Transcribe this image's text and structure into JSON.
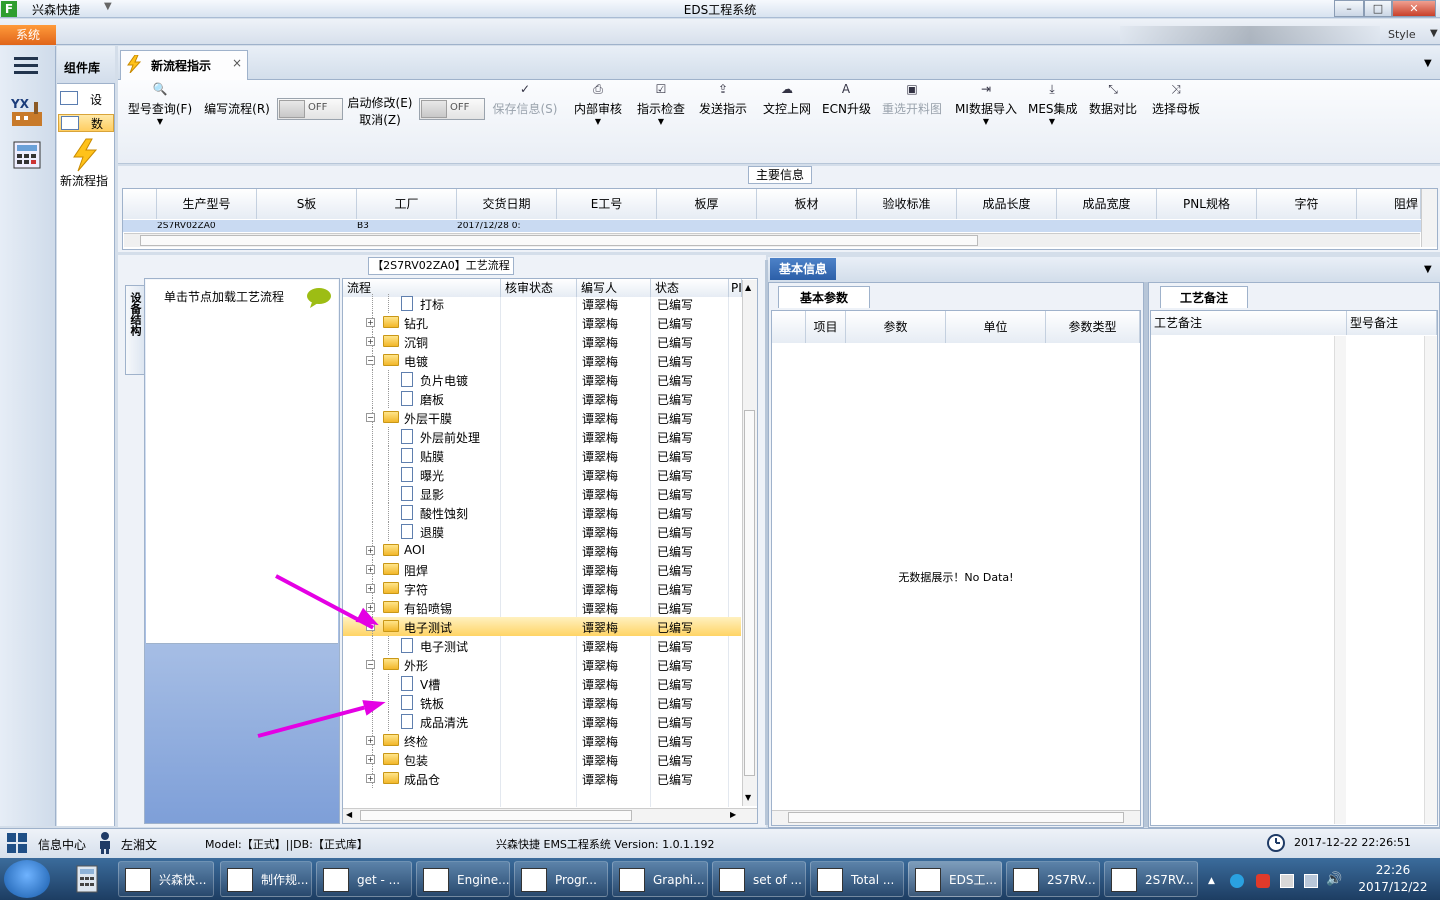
{
  "window": {
    "app_name": "兴森快捷",
    "title": "EDS工程系统"
  },
  "ribbon": {
    "system_tab": "系统",
    "style_label": "Style"
  },
  "component_library": {
    "header": "组件库",
    "items": [
      {
        "label": "设"
      },
      {
        "label": "数"
      }
    ],
    "new_flow_label": "新流程指"
  },
  "main_tab": {
    "label": "新流程指示"
  },
  "toolbar": {
    "query_model": "型号查询(F)",
    "write_flow": "编写流程(R)",
    "toggle1": "OFF",
    "start_modify": "启动修改(E)",
    "cancel": "取消(Z)",
    "toggle2": "OFF",
    "save_info": "保存信息(S)",
    "internal_review": "内部审核",
    "instruction_check": "指示检查",
    "send_instruction": "发送指示",
    "file_upload": "文控上网",
    "ecn_upgrade": "ECN升级",
    "reselect_cut": "重选开料图",
    "mi_import": "MI数据导入",
    "mes_integration": "MES集成",
    "data_compare": "数据对比",
    "select_mother": "选择母板"
  },
  "main_info": {
    "title": "主要信息",
    "columns": [
      "生产型号",
      "S板",
      "工厂",
      "交货日期",
      "E工号",
      "板厚",
      "板材",
      "验收标准",
      "成品长度",
      "成品宽度",
      "PNL规格",
      "字符",
      "阻焊"
    ],
    "row": [
      "2S7RV02ZA0",
      "",
      "B3",
      "2017/12/28 0:"
    ]
  },
  "process_panel": {
    "title": "【2S7RV02ZA0】工艺流程",
    "side_tab": "设备结构",
    "load_hint": "单击节点加载工艺流程",
    "columns": [
      "流程",
      "核审状态",
      "编写人",
      "状态",
      "PI"
    ],
    "rows": [
      {
        "name": "打标",
        "level": 2,
        "writer": "谭翠梅",
        "status": "已编写"
      },
      {
        "name": "钻孔",
        "level": 1,
        "writer": "谭翠梅",
        "status": "已编写"
      },
      {
        "name": "沉铜",
        "level": 1,
        "writer": "谭翠梅",
        "status": "已编写"
      },
      {
        "name": "电镀",
        "level": 1,
        "writer": "谭翠梅",
        "status": "已编写"
      },
      {
        "name": "负片电镀",
        "level": 2,
        "writer": "谭翠梅",
        "status": "已编写"
      },
      {
        "name": "磨板",
        "level": 2,
        "writer": "谭翠梅",
        "status": "已编写"
      },
      {
        "name": "外层干膜",
        "level": 1,
        "writer": "谭翠梅",
        "status": "已编写"
      },
      {
        "name": "外层前处理",
        "level": 2,
        "writer": "谭翠梅",
        "status": "已编写"
      },
      {
        "name": "贴膜",
        "level": 2,
        "writer": "谭翠梅",
        "status": "已编写"
      },
      {
        "name": "曝光",
        "level": 2,
        "writer": "谭翠梅",
        "status": "已编写"
      },
      {
        "name": "显影",
        "level": 2,
        "writer": "谭翠梅",
        "status": "已编写"
      },
      {
        "name": "酸性蚀刻",
        "level": 2,
        "writer": "谭翠梅",
        "status": "已编写"
      },
      {
        "name": "退膜",
        "level": 2,
        "writer": "谭翠梅",
        "status": "已编写"
      },
      {
        "name": "AOI",
        "level": 1,
        "writer": "谭翠梅",
        "status": "已编写"
      },
      {
        "name": "阻焊",
        "level": 1,
        "writer": "谭翠梅",
        "status": "已编写"
      },
      {
        "name": "字符",
        "level": 1,
        "writer": "谭翠梅",
        "status": "已编写"
      },
      {
        "name": "有铅喷锡",
        "level": 1,
        "writer": "谭翠梅",
        "status": "已编写"
      },
      {
        "name": "电子测试",
        "level": 1,
        "writer": "谭翠梅",
        "status": "已编写",
        "selected": true
      },
      {
        "name": "电子测试",
        "level": 2,
        "writer": "谭翠梅",
        "status": "已编写"
      },
      {
        "name": "外形",
        "level": 1,
        "writer": "谭翠梅",
        "status": "已编写"
      },
      {
        "name": "V槽",
        "level": 2,
        "writer": "谭翠梅",
        "status": "已编写"
      },
      {
        "name": "铣板",
        "level": 2,
        "writer": "谭翠梅",
        "status": "已编写"
      },
      {
        "name": "成品清洗",
        "level": 2,
        "writer": "谭翠梅",
        "status": "已编写"
      },
      {
        "name": "终检",
        "level": 1,
        "writer": "谭翠梅",
        "status": "已编写"
      },
      {
        "name": "包装",
        "level": 1,
        "writer": "谭翠梅",
        "status": "已编写"
      },
      {
        "name": "成品仓",
        "level": 1,
        "writer": "谭翠梅",
        "status": "已编写"
      }
    ]
  },
  "basic_info": {
    "tab": "基本信息",
    "subtab": "基本参数",
    "columns": [
      "项目",
      "参数",
      "单位",
      "参数类型"
    ],
    "empty_text": "无数据展示！No Data!"
  },
  "notes": {
    "subtab": "工艺备注",
    "columns": [
      "工艺备注",
      "型号备注"
    ]
  },
  "statusbar": {
    "info_center": "信息中心",
    "user": "左湘文",
    "model_db": "Model:【正式】||DB:【正式库】",
    "system": "兴森快捷 EMS工程系统 Version: 1.0.1.192",
    "datetime": "2017-12-22 22:26:51"
  },
  "taskbar": {
    "items": [
      {
        "label": "兴森快..."
      },
      {
        "label": "制作规..."
      },
      {
        "label": "get - ..."
      },
      {
        "label": "Engine..."
      },
      {
        "label": "Progr..."
      },
      {
        "label": "Graphi..."
      },
      {
        "label": "set of ..."
      },
      {
        "label": "Total ..."
      },
      {
        "label": "EDS工..."
      },
      {
        "label": "2S7RV..."
      },
      {
        "label": "2S7RV..."
      }
    ],
    "time": "22:26",
    "date": "2017/12/22"
  },
  "colors": {
    "accent": "#2c5fa8",
    "selected_row": "#ffd465",
    "annotation_arrow": "#e400e4"
  }
}
